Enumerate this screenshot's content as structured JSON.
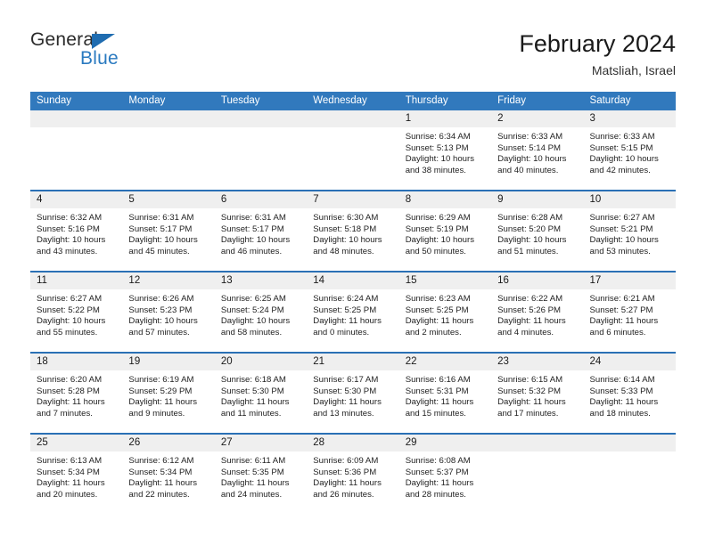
{
  "brand": {
    "name_part1": "General",
    "name_part2": "Blue",
    "triangle_color": "#1f6cb0",
    "blue_color": "#2a7ac0"
  },
  "header": {
    "title": "February 2024",
    "location": "Matsliah, Israel"
  },
  "theme": {
    "header_blue": "#3179bd",
    "week_divider_blue": "#2a70b5",
    "daynum_band": "#efefef"
  },
  "weekdays": [
    "Sunday",
    "Monday",
    "Tuesday",
    "Wednesday",
    "Thursday",
    "Friday",
    "Saturday"
  ],
  "weeks": [
    [
      {
        "day": "",
        "empty": true
      },
      {
        "day": "",
        "empty": true
      },
      {
        "day": "",
        "empty": true
      },
      {
        "day": "",
        "empty": true
      },
      {
        "day": "1",
        "sunrise": "Sunrise: 6:34 AM",
        "sunset": "Sunset: 5:13 PM",
        "daylight1": "Daylight: 10 hours",
        "daylight2": "and 38 minutes."
      },
      {
        "day": "2",
        "sunrise": "Sunrise: 6:33 AM",
        "sunset": "Sunset: 5:14 PM",
        "daylight1": "Daylight: 10 hours",
        "daylight2": "and 40 minutes."
      },
      {
        "day": "3",
        "sunrise": "Sunrise: 6:33 AM",
        "sunset": "Sunset: 5:15 PM",
        "daylight1": "Daylight: 10 hours",
        "daylight2": "and 42 minutes."
      }
    ],
    [
      {
        "day": "4",
        "sunrise": "Sunrise: 6:32 AM",
        "sunset": "Sunset: 5:16 PM",
        "daylight1": "Daylight: 10 hours",
        "daylight2": "and 43 minutes."
      },
      {
        "day": "5",
        "sunrise": "Sunrise: 6:31 AM",
        "sunset": "Sunset: 5:17 PM",
        "daylight1": "Daylight: 10 hours",
        "daylight2": "and 45 minutes."
      },
      {
        "day": "6",
        "sunrise": "Sunrise: 6:31 AM",
        "sunset": "Sunset: 5:17 PM",
        "daylight1": "Daylight: 10 hours",
        "daylight2": "and 46 minutes."
      },
      {
        "day": "7",
        "sunrise": "Sunrise: 6:30 AM",
        "sunset": "Sunset: 5:18 PM",
        "daylight1": "Daylight: 10 hours",
        "daylight2": "and 48 minutes."
      },
      {
        "day": "8",
        "sunrise": "Sunrise: 6:29 AM",
        "sunset": "Sunset: 5:19 PM",
        "daylight1": "Daylight: 10 hours",
        "daylight2": "and 50 minutes."
      },
      {
        "day": "9",
        "sunrise": "Sunrise: 6:28 AM",
        "sunset": "Sunset: 5:20 PM",
        "daylight1": "Daylight: 10 hours",
        "daylight2": "and 51 minutes."
      },
      {
        "day": "10",
        "sunrise": "Sunrise: 6:27 AM",
        "sunset": "Sunset: 5:21 PM",
        "daylight1": "Daylight: 10 hours",
        "daylight2": "and 53 minutes."
      }
    ],
    [
      {
        "day": "11",
        "sunrise": "Sunrise: 6:27 AM",
        "sunset": "Sunset: 5:22 PM",
        "daylight1": "Daylight: 10 hours",
        "daylight2": "and 55 minutes."
      },
      {
        "day": "12",
        "sunrise": "Sunrise: 6:26 AM",
        "sunset": "Sunset: 5:23 PM",
        "daylight1": "Daylight: 10 hours",
        "daylight2": "and 57 minutes."
      },
      {
        "day": "13",
        "sunrise": "Sunrise: 6:25 AM",
        "sunset": "Sunset: 5:24 PM",
        "daylight1": "Daylight: 10 hours",
        "daylight2": "and 58 minutes."
      },
      {
        "day": "14",
        "sunrise": "Sunrise: 6:24 AM",
        "sunset": "Sunset: 5:25 PM",
        "daylight1": "Daylight: 11 hours",
        "daylight2": "and 0 minutes."
      },
      {
        "day": "15",
        "sunrise": "Sunrise: 6:23 AM",
        "sunset": "Sunset: 5:25 PM",
        "daylight1": "Daylight: 11 hours",
        "daylight2": "and 2 minutes."
      },
      {
        "day": "16",
        "sunrise": "Sunrise: 6:22 AM",
        "sunset": "Sunset: 5:26 PM",
        "daylight1": "Daylight: 11 hours",
        "daylight2": "and 4 minutes."
      },
      {
        "day": "17",
        "sunrise": "Sunrise: 6:21 AM",
        "sunset": "Sunset: 5:27 PM",
        "daylight1": "Daylight: 11 hours",
        "daylight2": "and 6 minutes."
      }
    ],
    [
      {
        "day": "18",
        "sunrise": "Sunrise: 6:20 AM",
        "sunset": "Sunset: 5:28 PM",
        "daylight1": "Daylight: 11 hours",
        "daylight2": "and 7 minutes."
      },
      {
        "day": "19",
        "sunrise": "Sunrise: 6:19 AM",
        "sunset": "Sunset: 5:29 PM",
        "daylight1": "Daylight: 11 hours",
        "daylight2": "and 9 minutes."
      },
      {
        "day": "20",
        "sunrise": "Sunrise: 6:18 AM",
        "sunset": "Sunset: 5:30 PM",
        "daylight1": "Daylight: 11 hours",
        "daylight2": "and 11 minutes."
      },
      {
        "day": "21",
        "sunrise": "Sunrise: 6:17 AM",
        "sunset": "Sunset: 5:30 PM",
        "daylight1": "Daylight: 11 hours",
        "daylight2": "and 13 minutes."
      },
      {
        "day": "22",
        "sunrise": "Sunrise: 6:16 AM",
        "sunset": "Sunset: 5:31 PM",
        "daylight1": "Daylight: 11 hours",
        "daylight2": "and 15 minutes."
      },
      {
        "day": "23",
        "sunrise": "Sunrise: 6:15 AM",
        "sunset": "Sunset: 5:32 PM",
        "daylight1": "Daylight: 11 hours",
        "daylight2": "and 17 minutes."
      },
      {
        "day": "24",
        "sunrise": "Sunrise: 6:14 AM",
        "sunset": "Sunset: 5:33 PM",
        "daylight1": "Daylight: 11 hours",
        "daylight2": "and 18 minutes."
      }
    ],
    [
      {
        "day": "25",
        "sunrise": "Sunrise: 6:13 AM",
        "sunset": "Sunset: 5:34 PM",
        "daylight1": "Daylight: 11 hours",
        "daylight2": "and 20 minutes."
      },
      {
        "day": "26",
        "sunrise": "Sunrise: 6:12 AM",
        "sunset": "Sunset: 5:34 PM",
        "daylight1": "Daylight: 11 hours",
        "daylight2": "and 22 minutes."
      },
      {
        "day": "27",
        "sunrise": "Sunrise: 6:11 AM",
        "sunset": "Sunset: 5:35 PM",
        "daylight1": "Daylight: 11 hours",
        "daylight2": "and 24 minutes."
      },
      {
        "day": "28",
        "sunrise": "Sunrise: 6:09 AM",
        "sunset": "Sunset: 5:36 PM",
        "daylight1": "Daylight: 11 hours",
        "daylight2": "and 26 minutes."
      },
      {
        "day": "29",
        "sunrise": "Sunrise: 6:08 AM",
        "sunset": "Sunset: 5:37 PM",
        "daylight1": "Daylight: 11 hours",
        "daylight2": "and 28 minutes."
      },
      {
        "day": "",
        "empty": true
      },
      {
        "day": "",
        "empty": true
      }
    ]
  ]
}
